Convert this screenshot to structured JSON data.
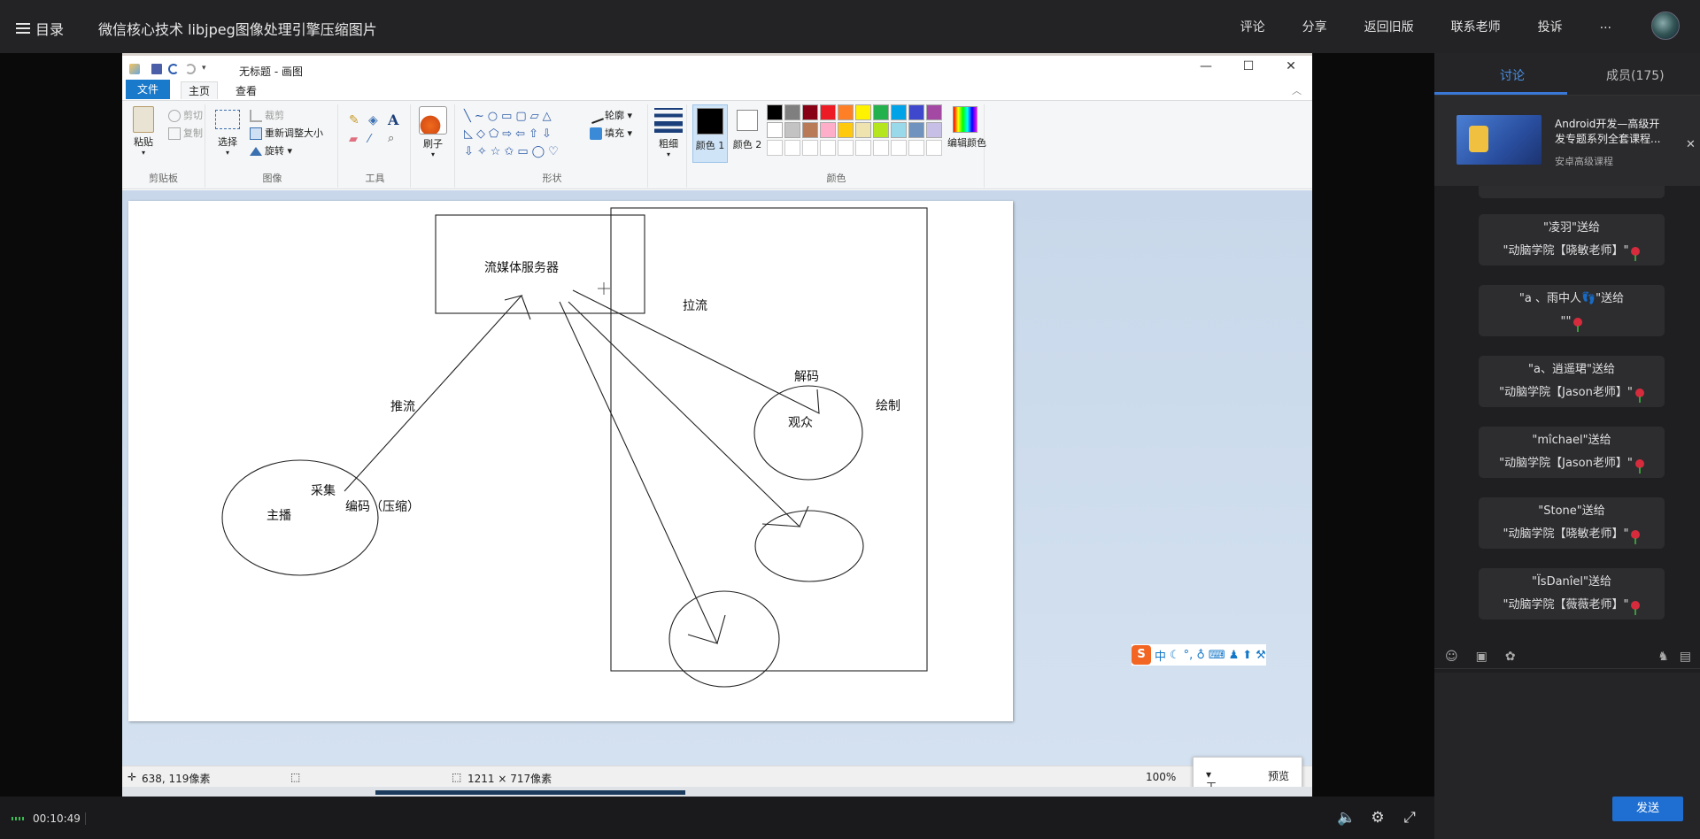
{
  "topbar": {
    "menu_label": "目录",
    "course_title": "微信核心技术 libjpeg图像处理引擎压缩图片",
    "actions": [
      "评论",
      "分享",
      "返回旧版",
      "联系老师",
      "投诉",
      "..."
    ]
  },
  "paint": {
    "window_title": "无标题 - 画图",
    "tabs": {
      "file": "文件",
      "home": "主页",
      "view": "查看"
    },
    "clipboard": {
      "paste": "粘贴",
      "cut": "剪切",
      "copy": "复制",
      "group": "剪贴板"
    },
    "image": {
      "select": "选择",
      "crop": "裁剪",
      "resize": "重新调整大小",
      "rotate": "旋转",
      "group": "图像"
    },
    "tools": {
      "group": "工具"
    },
    "brush": {
      "label": "刷子"
    },
    "shapes": {
      "outline": "轮廓",
      "fill": "填充",
      "group": "形状"
    },
    "size": {
      "label": "粗细"
    },
    "colors": {
      "color1": "颜色 1",
      "color2": "颜色 2",
      "edit": "编辑颜色",
      "group": "颜色",
      "palette_row1": [
        "#000000",
        "#7f7f7f",
        "#880015",
        "#ed1c24",
        "#ff7f27",
        "#fff200",
        "#22b14c",
        "#00a2e8",
        "#3f48cc",
        "#a349a4"
      ],
      "palette_row2": [
        "#ffffff",
        "#c3c3c3",
        "#b97a57",
        "#ffaec9",
        "#ffc90e",
        "#efe4b0",
        "#b5e61d",
        "#99d9ea",
        "#7092be",
        "#c8bfe7"
      ]
    },
    "drawing_labels": {
      "server": "流媒体服务器",
      "pull": "拉流",
      "decode": "解码",
      "render": "绘制",
      "push": "推流",
      "viewer": "观众",
      "capture": "采集",
      "encode": "编码（压缩）",
      "anchor": "主播"
    },
    "ime": {
      "logo": "S",
      "mode": "中"
    },
    "status": {
      "cursor_pos": "638, 119像素",
      "canvas_size": "1211 × 717像素",
      "zoom": "100%"
    },
    "zoom_popup": {
      "tools": "工具",
      "preview": "预览"
    }
  },
  "player": {
    "timecode": "00:10:49"
  },
  "sidebar": {
    "tab_discuss": "讨论",
    "tab_members": "成员(175)",
    "ad": {
      "title": "Android开发—高级开发专题系列全套课程...",
      "subtitle": "安卓高级课程"
    },
    "messages": [
      {
        "line1": "\"凌羽\"送给",
        "line2": "\"动脑学院【晓敏老师】\""
      },
      {
        "line1": "\"a 、雨中人👣\"送给",
        "line2": "\"\""
      },
      {
        "line1": "\"a、逍遥珺\"送给",
        "line2": "\"动脑学院【Jason老师】\""
      },
      {
        "line1": "\"mîchael\"送给",
        "line2": "\"动脑学院【Jason老师】\""
      },
      {
        "line1": "\"Stone\"送给",
        "line2": "\"动脑学院【晓敏老师】\""
      },
      {
        "line1": "\"ÏsDanîel\"送给",
        "line2": "\"动脑学院【薇薇老师】\""
      }
    ],
    "send_label": "发送"
  }
}
